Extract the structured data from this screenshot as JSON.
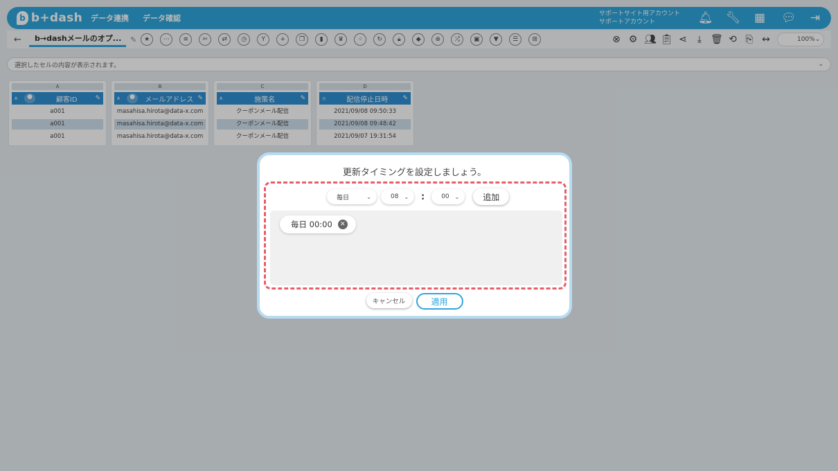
{
  "app": {
    "logo": "b+dash"
  },
  "topnav": {
    "items": [
      "データ連携",
      "データ確認"
    ]
  },
  "account": {
    "line1": "サポートサイト用アカウント",
    "line2": "サポートアカウント"
  },
  "toolbar": {
    "back": "←",
    "report_name": "b→dashメールのオプ...",
    "zoom": "100%"
  },
  "formula": {
    "placeholder": "選択したセルの内容が表示されます。"
  },
  "columns": [
    {
      "letter": "A",
      "name": "顧客ID",
      "cells": [
        "a001",
        "a001",
        "a001"
      ]
    },
    {
      "letter": "B",
      "name": "メールアドレス",
      "cells": [
        "masahisa.hirota@data-x.com",
        "masahisa.hirota@data-x.com",
        "masahisa.hirota@data-x.com"
      ]
    },
    {
      "letter": "C",
      "name": "施策名",
      "cells": [
        "クーポンメール配信",
        "クーポンメール配信",
        "クーポンメール配信"
      ]
    },
    {
      "letter": "D",
      "name": "配信停止日時",
      "cells": [
        "2021/09/08 09:50:33",
        "2021/09/08 09:48:42",
        "2021/09/07 19:31:54"
      ]
    }
  ],
  "dialog": {
    "title": "更新タイミングを設定しましょう。",
    "frequency": "毎日",
    "hour": "08",
    "minute": "00",
    "colon": ":",
    "add_label": "追加",
    "chips": [
      "毎日 00:00"
    ],
    "cancel_label": "キャンセル",
    "apply_label": "適用"
  },
  "colors": {
    "brand": "#2fa6dc",
    "dashed": "#e55e6a",
    "column_head": "#2f8fd2"
  }
}
